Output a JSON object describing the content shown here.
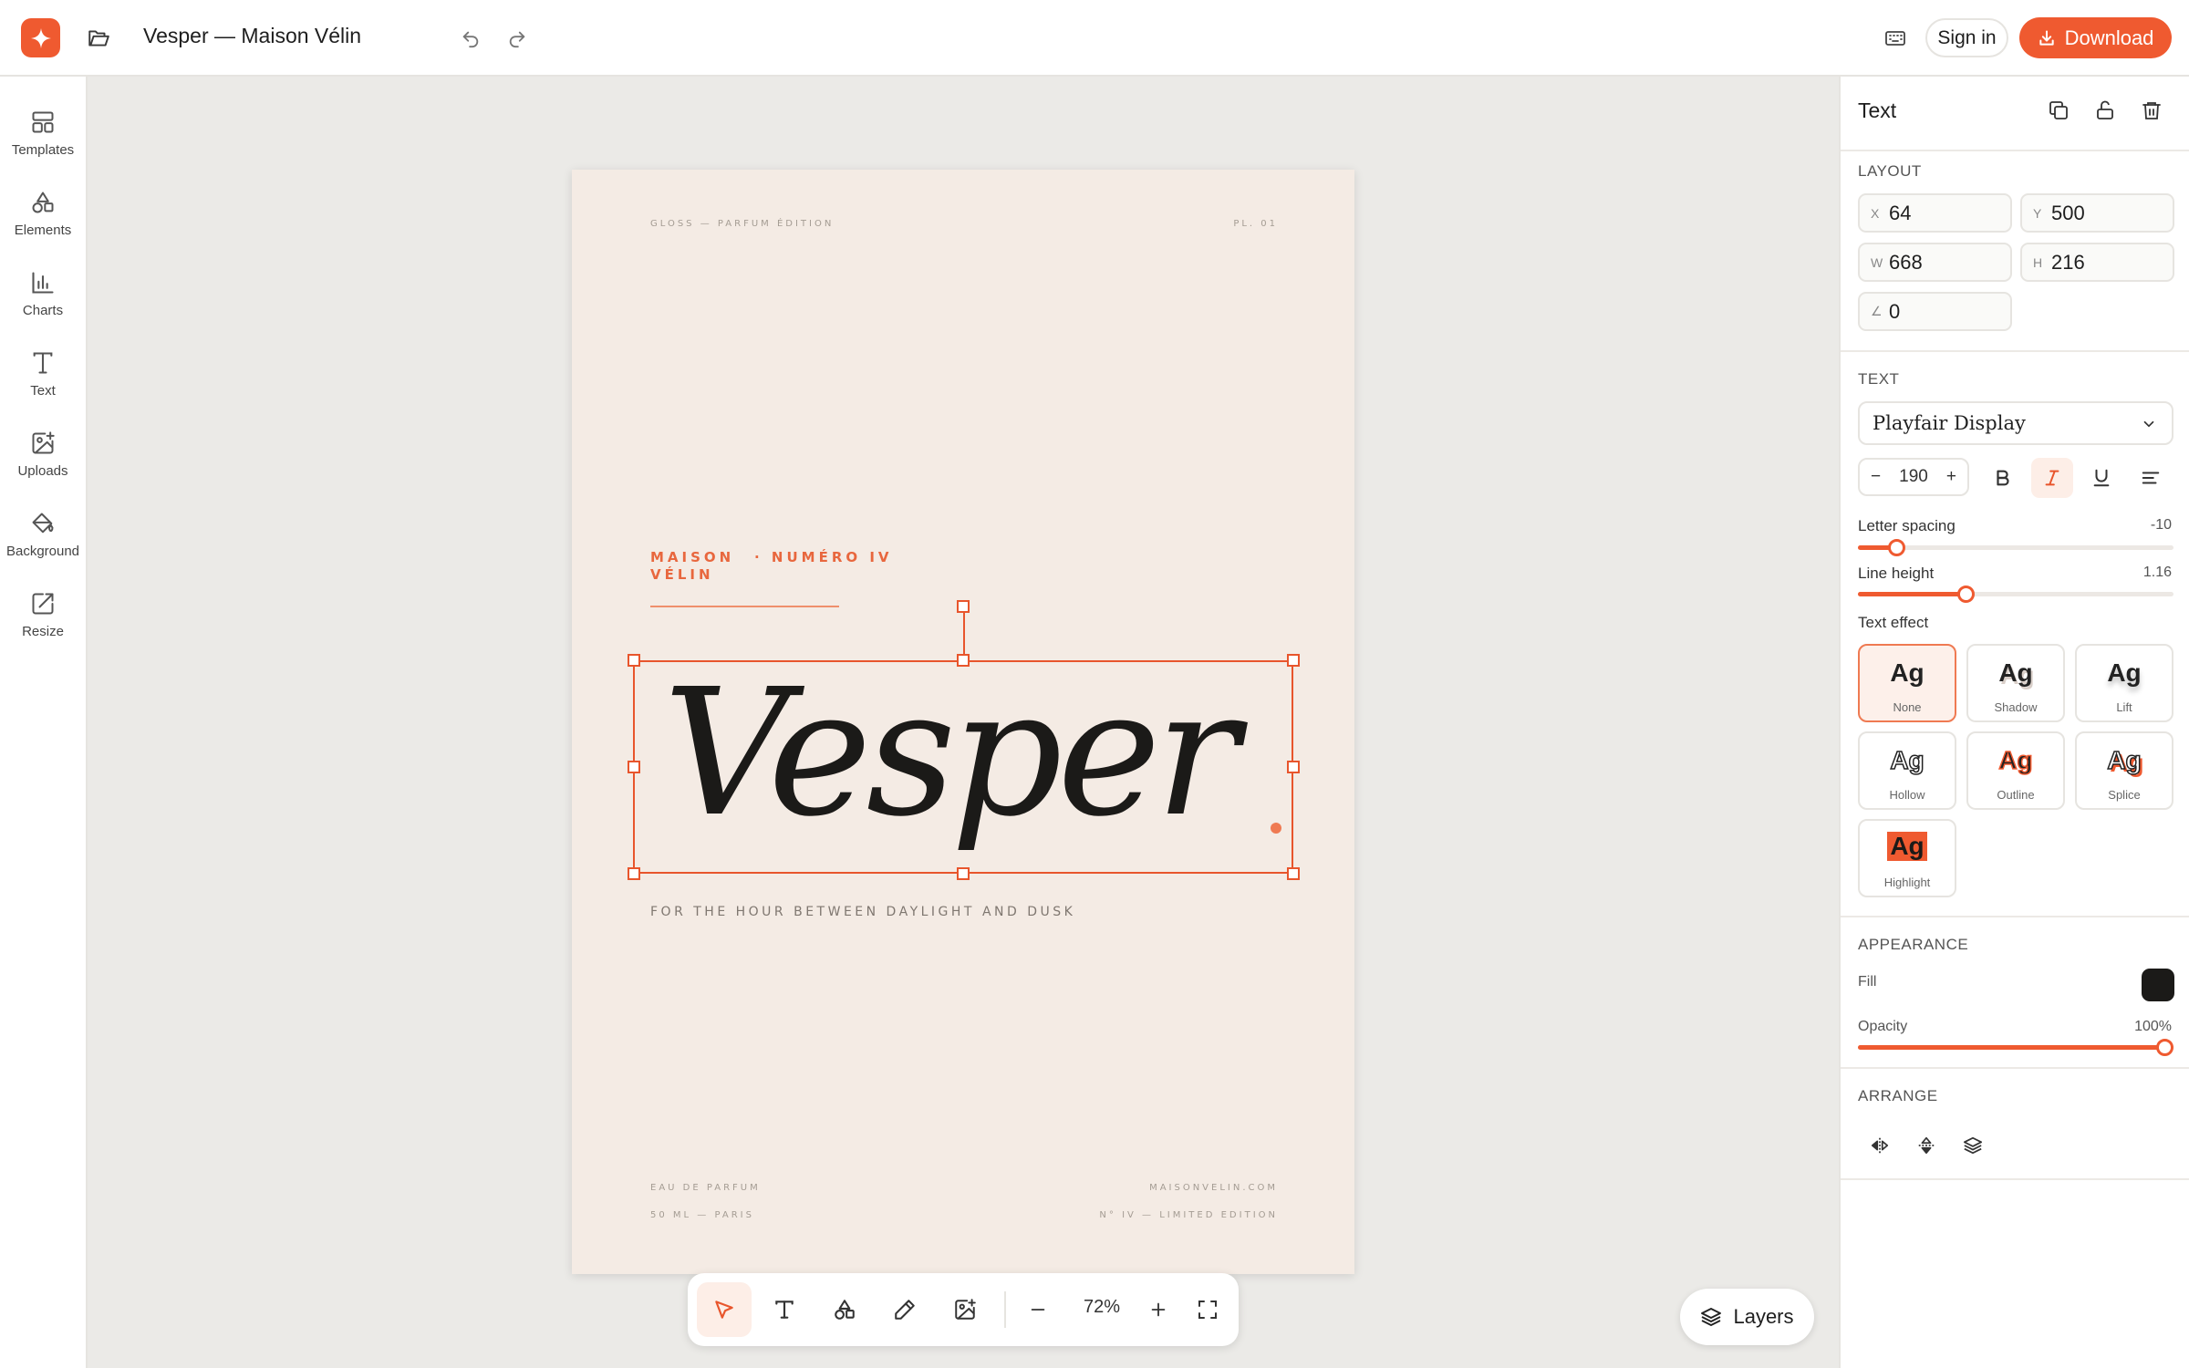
{
  "app": {
    "doc_title": "Vesper — Maison Vélin",
    "signin_label": "Sign in",
    "download_label": "Download",
    "accent_color": "#ef5a30"
  },
  "sidebar": {
    "items": [
      {
        "label": "Templates",
        "icon": "templates-icon"
      },
      {
        "label": "Elements",
        "icon": "elements-icon"
      },
      {
        "label": "Charts",
        "icon": "charts-icon"
      },
      {
        "label": "Text",
        "icon": "text-icon"
      },
      {
        "label": "Uploads",
        "icon": "uploads-icon"
      },
      {
        "label": "Background",
        "icon": "background-icon"
      },
      {
        "label": "Resize",
        "icon": "resize-icon"
      }
    ]
  },
  "page": {
    "top_left": "GLOSS — PARFUM ÉDITION",
    "top_right": "PL. 01",
    "brand_line1": "MAISON",
    "brand_line2": "VÉLIN",
    "brand_numero": "· NUMÉRO IV",
    "headline": "Vesper",
    "tagline": "FOR THE HOUR BETWEEN DAYLIGHT AND DUSK",
    "bottom_left_1": "EAU DE PARFUM",
    "bottom_left_2": "50 ML — PARIS",
    "bottom_right_1": "MAISONVELIN.COM",
    "bottom_right_2": "N° IV — LIMITED EDITION"
  },
  "toolbar": {
    "zoom": "72%"
  },
  "layers_label": "Layers",
  "panel": {
    "title": "Text",
    "layout_label": "LAYOUT",
    "x_label": "X",
    "x_value": "64",
    "y_label": "Y",
    "y_value": "500",
    "w_label": "W",
    "w_value": "668",
    "h_label": "H",
    "h_value": "216",
    "angle_label": "∠",
    "angle_value": "0",
    "text_label": "TEXT",
    "font_family": "Playfair Display",
    "font_size": "190",
    "letter_spacing_label": "Letter spacing",
    "letter_spacing_value": "-10",
    "letter_spacing_fraction": 0.12,
    "line_height_label": "Line height",
    "line_height_value": "1.16",
    "line_height_fraction": 0.34,
    "text_effect_label": "Text effect",
    "effects": [
      "None",
      "Shadow",
      "Lift",
      "Hollow",
      "Outline",
      "Splice",
      "Highlight"
    ],
    "effect_glyph": "Ag",
    "active_effect": "None",
    "appearance_label": "APPEARANCE",
    "fill_label": "Fill",
    "fill_color": "#1b1a18",
    "opacity_label": "Opacity",
    "opacity_value": "100%",
    "opacity_fraction": 1.0,
    "arrange_label": "ARRANGE"
  }
}
